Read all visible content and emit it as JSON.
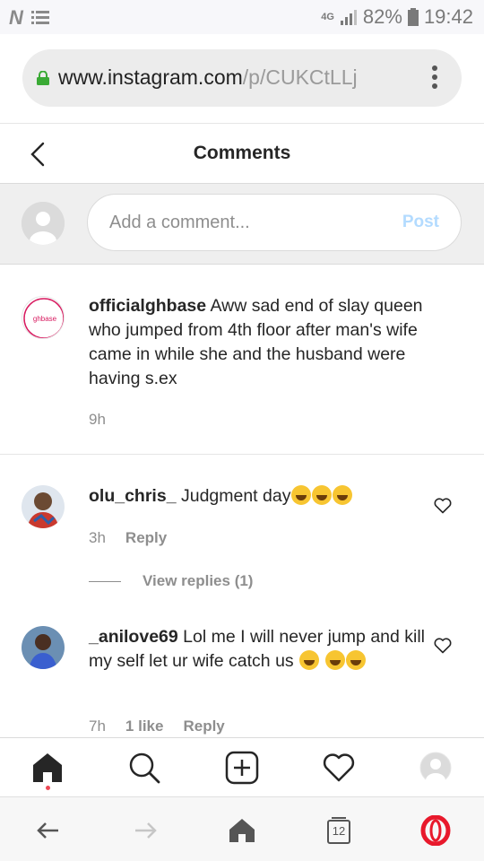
{
  "status_bar": {
    "carrier_logo": "N",
    "network": "4G",
    "battery": "82%",
    "time": "19:42"
  },
  "browser": {
    "url_host": "www.instagram.com",
    "url_path": "/p/CUKCtLLj",
    "menu_icon": "kebab-menu-icon"
  },
  "header": {
    "title": "Comments"
  },
  "add_comment": {
    "placeholder": "Add a comment...",
    "post_label": "Post"
  },
  "caption": {
    "username": "officialghbase",
    "text": "Aww sad end of slay queen who jumped from 4th floor after man's wife came in while she and the husband were having s.ex",
    "time": "9h",
    "avatar_text": "ghbase"
  },
  "comments": [
    {
      "username": "olu_chris_",
      "text": "Judgment day",
      "emoji_count": 3,
      "time": "3h",
      "reply_label": "Reply",
      "view_replies": "View replies (1)"
    },
    {
      "username": "_anilove69",
      "text": "Lol me I will never jump and kill my self let ur wife catch us",
      "emoji_count": 3,
      "time": "7h",
      "likes": "1 like",
      "reply_label": "Reply"
    }
  ],
  "browser_nav": {
    "tabs_count": "12"
  },
  "colors": {
    "post_disabled": "#b3dbff",
    "meta_grey": "#8e8e8e",
    "opera_red": "#e8192c",
    "notification_dot": "#ed4956"
  }
}
